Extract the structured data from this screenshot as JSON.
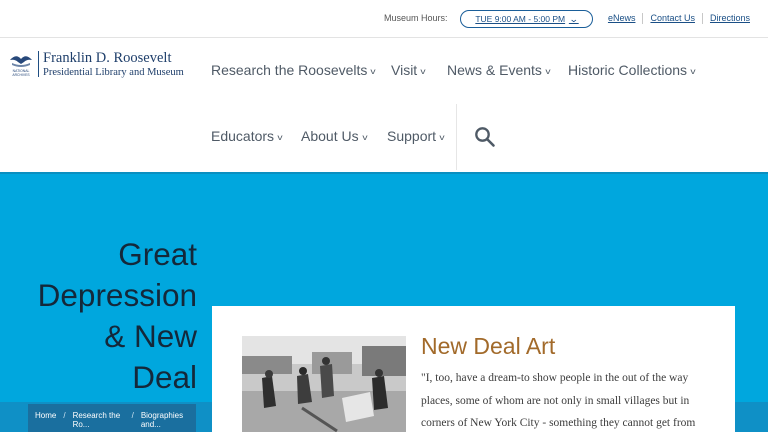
{
  "topbar": {
    "hours_label": "Museum Hours:",
    "hours_value": "TUE 9:00 AM - 5:00 PM",
    "links": [
      "eNews",
      "Contact Us",
      "Directions"
    ]
  },
  "logo": {
    "line1": "Franklin D. Roosevelt",
    "line2": "Presidential Library and Museum",
    "mark_text": "NATIONAL ARCHIVES"
  },
  "nav": {
    "items": [
      "Research the Roosevelts",
      "Visit",
      "News & Events",
      "Historic Collections",
      "Educators",
      "About Us",
      "Support"
    ],
    "search_icon": "search-icon"
  },
  "hero": {
    "title_lines": [
      "Great",
      "Depression",
      "& New",
      "Deal"
    ],
    "breadcrumb": [
      "Home",
      "Research the Ro...",
      "Biographies and..."
    ]
  },
  "card": {
    "title": "New Deal Art",
    "quote": "\"I, too, have a dream-to show people in the out of the way places, some of whom are not only in small villages but in corners of New York City - something they cannot get from"
  },
  "colors": {
    "hero_bg": "#00a7de",
    "card_title": "#a26a2a",
    "link": "#1a4f86",
    "breadcrumb_bg": "#1a6f9f"
  }
}
